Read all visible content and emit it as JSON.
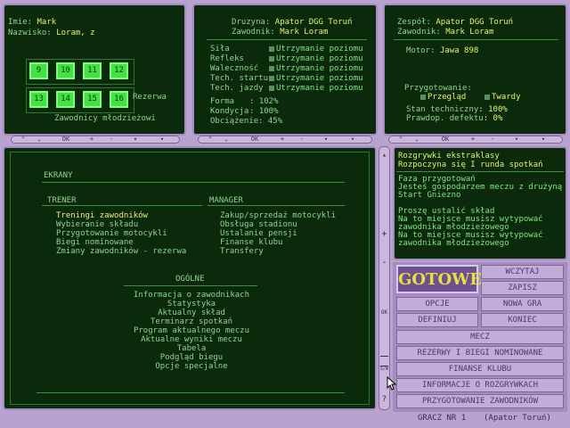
{
  "rider": {
    "imie_label": "Imie:",
    "imie_value": "Mark",
    "nazwisko_label": "Nazwisko:",
    "nazwisko_value": "Loram, z",
    "slots_top": [
      "9",
      "10",
      "11",
      "12"
    ],
    "slots_bottom": [
      "13",
      "14",
      "15",
      "16"
    ],
    "rezerwa": "Rezerwa",
    "mlodziezowi": "Zawodnicy młodzieżowi"
  },
  "team": {
    "druzyna_label": "Druzyna:",
    "druzyna_value": "Apator DGG Toruń",
    "zawodnik_label": "Zawodnik:",
    "zawodnik_value": "Mark Loram",
    "stats": [
      {
        "name": "Siła",
        "status": "Utrzymanie poziomu"
      },
      {
        "name": "Refleks",
        "status": "Utrzymanie poziomu"
      },
      {
        "name": "Waleczność",
        "status": "Utrzymanie poziomu"
      },
      {
        "name": "Tech. startu",
        "status": "Utrzymanie poziomu"
      },
      {
        "name": "Tech. jazdy",
        "status": "Utrzymanie poziomu"
      }
    ],
    "forma_label": "Forma",
    "forma_value": ": 102%",
    "kondycja_label": "Kondycja",
    "kondycja_value": ": 100%",
    "obciazenie_label": "Obciążenie",
    "obciazenie_value": ": 45%"
  },
  "bike": {
    "zespol_label": "Zespół:",
    "zespol_value": "Apator DGG Toruń",
    "zawodnik_label": "Zawodnik:",
    "zawodnik_value": "Mark Loram",
    "motor_label": "Motor:",
    "motor_value": "Jawa 898",
    "przygotowanie": "Przygotowanie:",
    "przeglad": "Przegląd",
    "twardy": "Twardy",
    "stan_label": "Stan techniczny",
    "stan_value": ": 100%",
    "defekt_label": "Prawdop. defektu",
    "defekt_value": ": 0%"
  },
  "toolbars": {
    "ok": "OK",
    "plus": "+",
    "minus": "-"
  },
  "side_scroll": {
    "plus": "+",
    "minus": "-",
    "ok": "OK",
    "sw": "S/W",
    "help": "?"
  },
  "menu": {
    "ekrany": "EKRANY",
    "trener": "TRENER",
    "manager": "MANAGER",
    "trener_items": [
      "Treningi zawodników",
      "Wybieranie składu",
      "Przygotowanie motocykli",
      "Biegi nominowane",
      "Zmiany zawodników - rezerwa"
    ],
    "manager_items": [
      "Zakup/sprzedaż motocykli",
      "Obsługa stadionu",
      "Ustalanie pensji",
      "Finanse klubu",
      "Transfery"
    ],
    "ogolne": "OGÓLNE",
    "ogolne_items": [
      "Informacja o zawodnikach",
      "Statystyka",
      "Aktualny skład",
      "Terminarz spotkań",
      "Program aktualnego meczu",
      "Aktualne wyniki meczu",
      "Tabela",
      "Podgląd biegu",
      "Opcje specjalne"
    ]
  },
  "info": {
    "title1": "Rozgrywki ekstraklasy",
    "title2": "Rozpoczyna się I runda spotkań",
    "lines": [
      "Faza przygotowań",
      "Jesteś gospodarzem meczu z drużyną",
      "Start Gniezno",
      "",
      "Proszę ustalić skład",
      "Na to miejsce musisz wytypować",
      "zawodnika młodzieżowego",
      "Na to miejsce musisz wytypować",
      "zawodnika młodzieżowego"
    ]
  },
  "buttons": {
    "gotowe": "GOTOWE",
    "wczytaj": "WCZYTAJ",
    "zapisz": "ZAPISZ",
    "opcje": "OPCJE",
    "nowa_gra": "NOWA GRA",
    "definiuj": "DEFINIUJ",
    "koniec": "KONIEC",
    "mecz": "MECZ",
    "rezerwy": "REZERWY I BIEGI NOMINOWANE",
    "finanse": "FINANSE KLUBU",
    "informacje": "INFORMACJE O ROZGRYWKACH",
    "przygotowanie": "PRZYGOTOWANIE ZAWODNIKÓW"
  },
  "status": {
    "gracz": "GRACZ NR 1",
    "team": "(Apator Toruń)"
  },
  "colors": {
    "panel_bg": "#0b2a0b",
    "frame": "#b9a2cf",
    "label": "#8fd48f",
    "value": "#e6f26a",
    "gotowe": "#e2e23a"
  }
}
